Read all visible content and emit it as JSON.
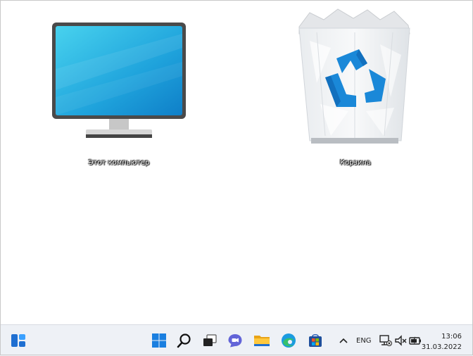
{
  "desktop": {
    "icons": [
      {
        "label": "Этот компьютер",
        "icon": "this-pc-monitor-icon"
      },
      {
        "label": "Корзина",
        "icon": "recycle-bin-icon"
      }
    ]
  },
  "taskbar": {
    "widgets_icon": "widgets-icon",
    "pinned": [
      {
        "icon": "start-windows-icon"
      },
      {
        "icon": "search-icon"
      },
      {
        "icon": "task-view-icon"
      },
      {
        "icon": "teams-chat-icon"
      },
      {
        "icon": "file-explorer-icon"
      },
      {
        "icon": "edge-browser-icon"
      },
      {
        "icon": "microsoft-store-icon"
      }
    ],
    "tray": {
      "language": "ENG",
      "time": "13:06",
      "date": "31.03.2022"
    }
  },
  "colors": {
    "monitor_screen": "#26a5dc",
    "recycle_blue": "#1a88d8",
    "taskbar_bg": "#eef1f6"
  }
}
